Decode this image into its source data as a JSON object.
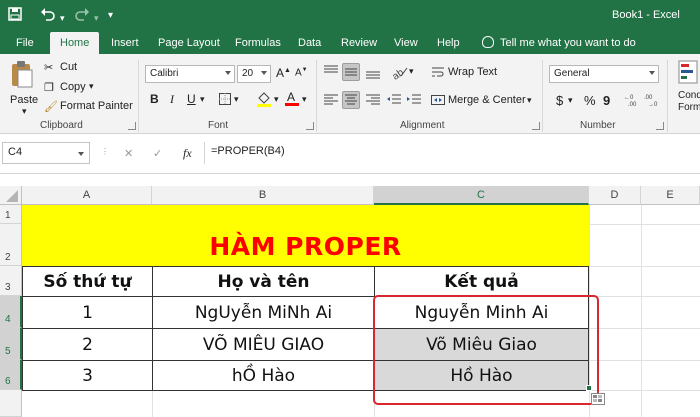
{
  "app": {
    "doc_title": "Book1  -  Excel",
    "quick_access": [
      "save-icon",
      "undo-icon",
      "redo-icon",
      "customize-icon"
    ]
  },
  "tabs": {
    "file": "File",
    "home": "Home",
    "insert": "Insert",
    "page_layout": "Page Layout",
    "formulas": "Formulas",
    "data": "Data",
    "review": "Review",
    "view": "View",
    "help": "Help",
    "tell_me": "Tell me what you want to do"
  },
  "ribbon": {
    "clipboard": {
      "paste": "Paste",
      "cut": "Cut",
      "copy": "Copy",
      "format_painter": "Format Painter",
      "label": "Clipboard"
    },
    "font": {
      "name": "Calibri",
      "size": "20",
      "grow": "A",
      "shrink": "A",
      "bold": "B",
      "italic": "I",
      "underline": "U",
      "label": "Font"
    },
    "alignment": {
      "wrap_text": "Wrap Text",
      "merge_center": "Merge & Center",
      "label": "Alignment"
    },
    "number": {
      "format": "General",
      "currency": "$",
      "percent": "%",
      "comma": "9",
      "label": "Number"
    },
    "styles": {
      "cond_top": "Cond",
      "cond_bottom": "Forma"
    }
  },
  "formula_bar": {
    "name_box": "C4",
    "cancel": "✕",
    "enter": "✓",
    "fx": "fx",
    "formula": "=PROPER(B4)"
  },
  "columns": [
    "A",
    "B",
    "C",
    "D",
    "E"
  ],
  "rows": [
    "1",
    "2",
    "3",
    "4",
    "5",
    "6"
  ],
  "sheet": {
    "title": "HÀM PROPER",
    "headers": [
      "Số thứ tự",
      "Họ và tên",
      "Kết quả"
    ],
    "rows": [
      {
        "stt": "1",
        "name": "NgUyễn MiNh Ai",
        "result": "Nguyễn Minh Ai"
      },
      {
        "stt": "2",
        "name": "VÕ MIÊU GIAO",
        "result": "Võ Miêu Giao"
      },
      {
        "stt": "3",
        "name": "hỒ Hào",
        "result": "Hồ Hào"
      }
    ]
  },
  "colors": {
    "excel_green": "#217346",
    "title_fill": "#ffff00",
    "title_text": "#ff0000",
    "result_fill": "#d9d9d9",
    "highlight_outline": "#d9272e"
  }
}
